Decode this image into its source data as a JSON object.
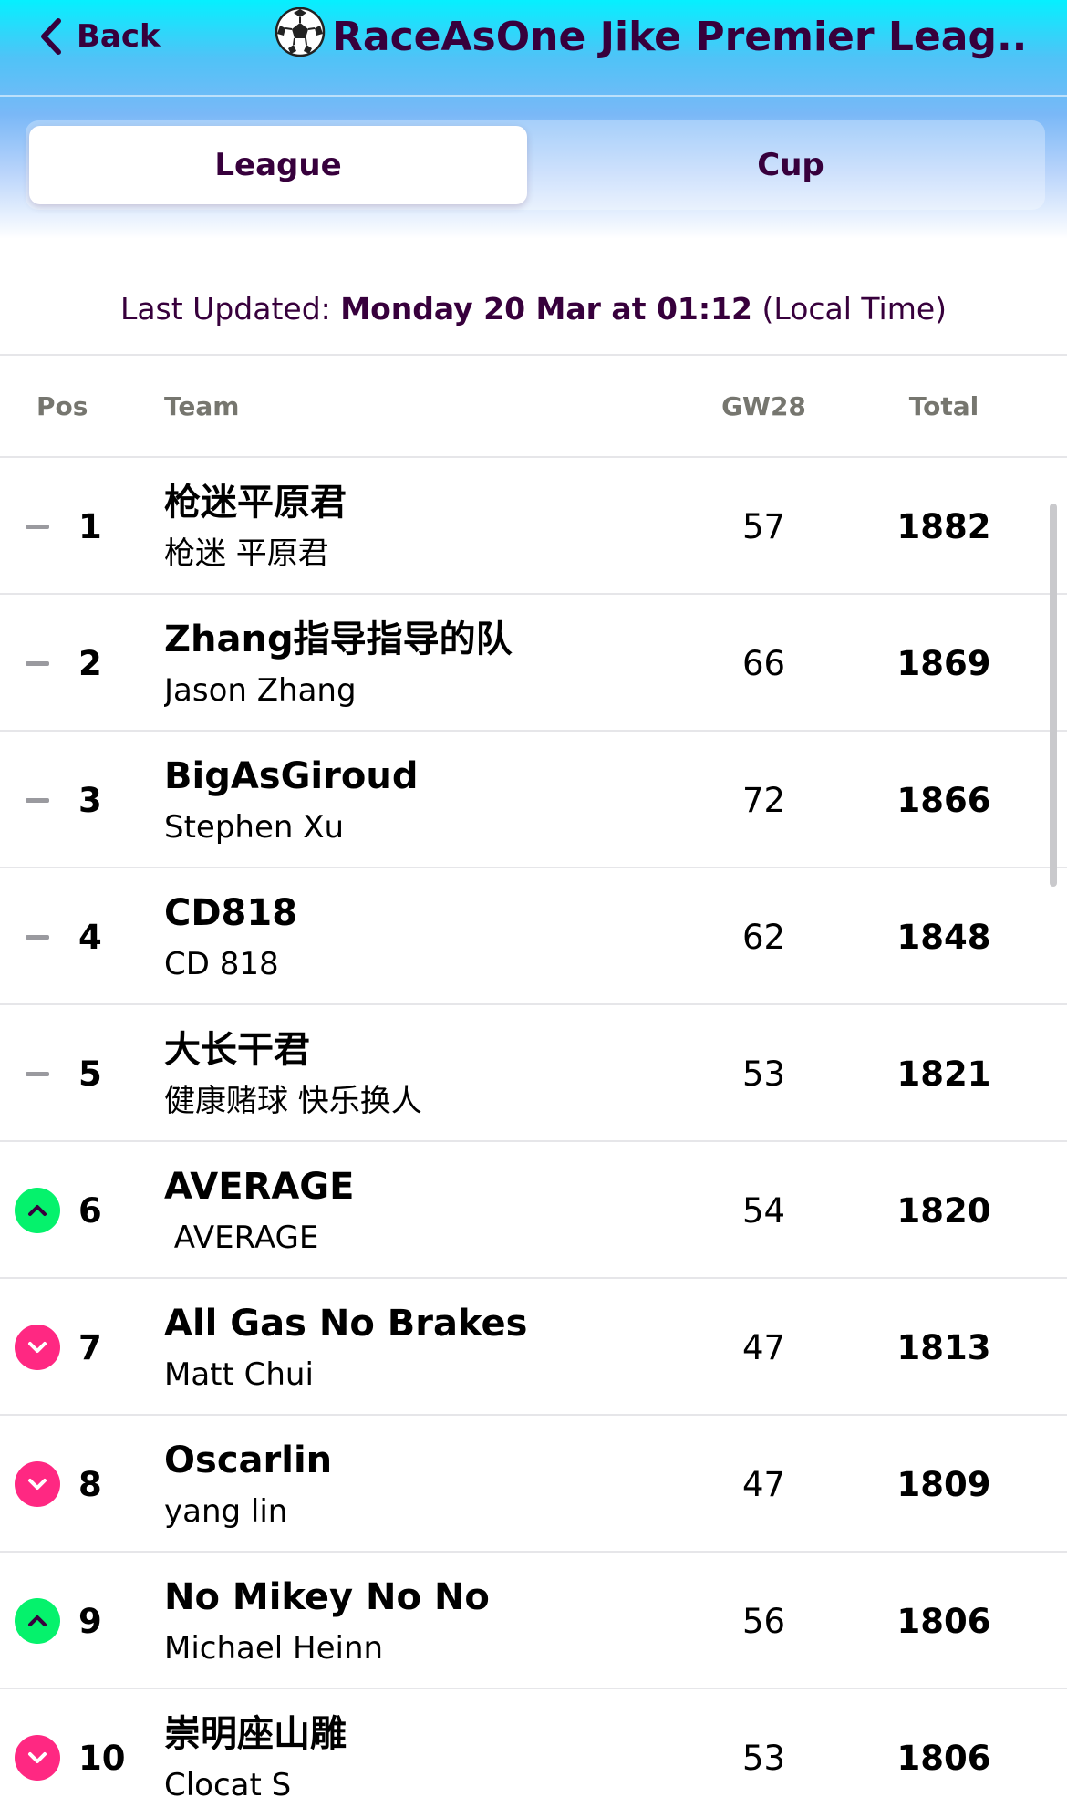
{
  "header": {
    "back_label": "Back",
    "title": "RaceAsOne Jike Premier Leag..."
  },
  "tabs": [
    {
      "label": "League",
      "active": true
    },
    {
      "label": "Cup",
      "active": false
    }
  ],
  "last_updated": {
    "prefix": "Last Updated:",
    "datetime": "Monday 20 Mar at 01:12",
    "suffix": "(Local Time)"
  },
  "table": {
    "columns": {
      "pos": "Pos",
      "team": "Team",
      "gw": "GW28",
      "total": "Total"
    },
    "rows": [
      {
        "movement": "same",
        "pos": "1",
        "team": "枪迷平原君",
        "manager": "枪迷 平原君",
        "gw": "57",
        "total": "1882"
      },
      {
        "movement": "same",
        "pos": "2",
        "team": "Zhang指导指导的队",
        "manager": "Jason Zhang",
        "gw": "66",
        "total": "1869"
      },
      {
        "movement": "same",
        "pos": "3",
        "team": "BigAsGiroud",
        "manager": "Stephen Xu",
        "gw": "72",
        "total": "1866"
      },
      {
        "movement": "same",
        "pos": "4",
        "team": "CD818",
        "manager": "CD 818",
        "gw": "62",
        "total": "1848"
      },
      {
        "movement": "same",
        "pos": "5",
        "team": "大长干君",
        "manager": "健康赌球 快乐换人",
        "gw": "53",
        "total": "1821"
      },
      {
        "movement": "up",
        "pos": "6",
        "team": "AVERAGE",
        "manager": " AVERAGE",
        "gw": "54",
        "total": "1820"
      },
      {
        "movement": "down",
        "pos": "7",
        "team": "All Gas No Brakes",
        "manager": "Matt Chui",
        "gw": "47",
        "total": "1813"
      },
      {
        "movement": "down",
        "pos": "8",
        "team": "Oscarlin",
        "manager": "yang lin",
        "gw": "47",
        "total": "1809"
      },
      {
        "movement": "up",
        "pos": "9",
        "team": "No Mikey No No",
        "manager": "Michael Heinn",
        "gw": "56",
        "total": "1806"
      },
      {
        "movement": "down",
        "pos": "10",
        "team": "崇明座山雕",
        "manager": "Clocat S",
        "gw": "53",
        "total": "1806"
      }
    ]
  },
  "icons": {
    "back": "chevron-left-icon",
    "title": "soccer-ball-icon",
    "same": "no-change-dash-icon",
    "up": "rank-up-icon",
    "down": "rank-down-icon"
  },
  "colors": {
    "primary": "#37003c",
    "up": "#05f26c",
    "down": "#ff2882",
    "header_top": "#05f0ff"
  }
}
